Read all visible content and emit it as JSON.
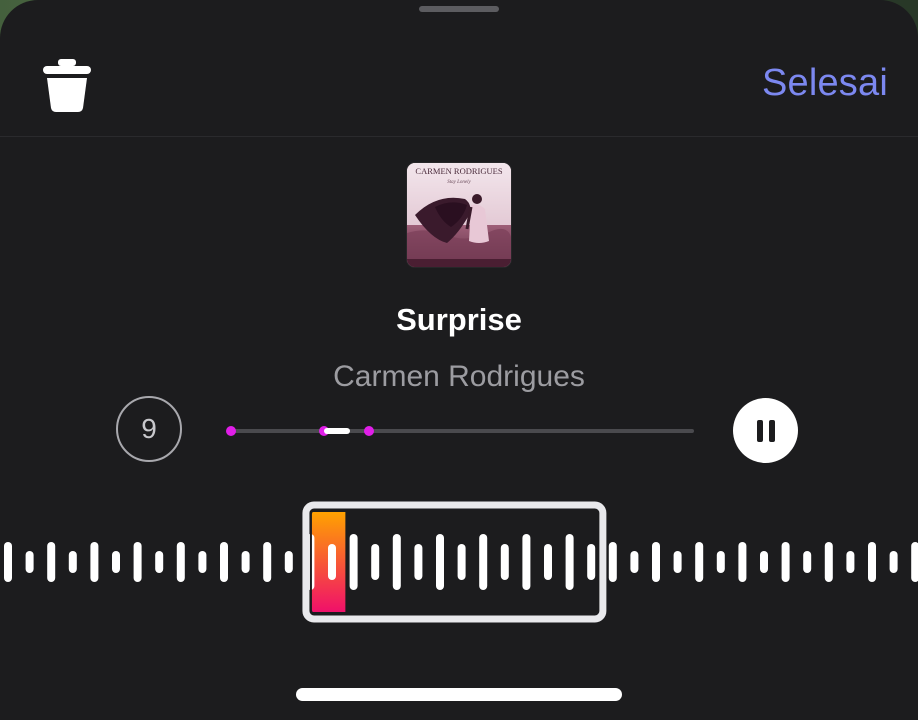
{
  "header": {
    "delete_icon": "trash-icon",
    "done_label": "Selesai"
  },
  "track": {
    "album_art_title": "CARMEN RODRIGUES",
    "album_art_subtitle": "Stay Lonely",
    "title": "Surprise",
    "artist": "Carmen Rodrigues"
  },
  "controls": {
    "clip_count": "9",
    "scrubber_position": 0.21,
    "pause_icon": "pause-icon"
  },
  "clip_selector": {
    "selected_start": 0.33,
    "selected_end": 0.66,
    "playhead_progress": 0.12
  },
  "colors": {
    "accent": "#7c88f0",
    "marker": "#e01ee8",
    "playhead_top": "#ffa200",
    "playhead_bottom": "#f0106a",
    "background": "#1c1c1e"
  }
}
